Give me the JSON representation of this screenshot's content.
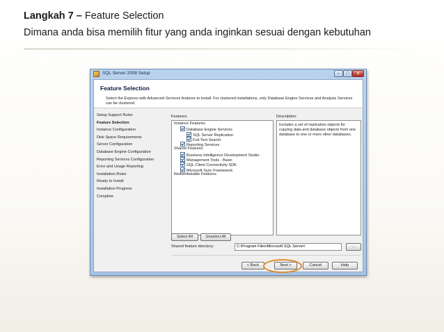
{
  "slide": {
    "title_bold": "Langkah 7 –",
    "title_rest": " Feature Selection",
    "subtitle": "Dimana anda bisa memilih fitur yang anda inginkan sesuai dengan kebutuhan"
  },
  "window": {
    "title": "SQL Server 2008 Setup",
    "minimize": "–",
    "maximize": "□",
    "close": "x"
  },
  "header": {
    "title": "Feature Selection",
    "description": "Select the Express with Advanced Services features to install. For clustered installations, only Database Engine Services and Analysis Services can be clustered."
  },
  "steps": [
    {
      "label": "Setup Support Rules",
      "active": false
    },
    {
      "label": "Feature Selection",
      "active": true
    },
    {
      "label": "Instance Configuration",
      "active": false
    },
    {
      "label": "Disk Space Requirements",
      "active": false
    },
    {
      "label": "Server Configuration",
      "active": false
    },
    {
      "label": "Database Engine Configuration",
      "active": false
    },
    {
      "label": "Reporting Services Configuration",
      "active": false
    },
    {
      "label": "Error and Usage Reporting",
      "active": false
    },
    {
      "label": "Installation Rules",
      "active": false
    },
    {
      "label": "Ready to Install",
      "active": false
    },
    {
      "label": "Installation Progress",
      "active": false
    },
    {
      "label": "Complete",
      "active": false
    }
  ],
  "features_label": "Features:",
  "features": [
    {
      "label": "Instance Features",
      "level": 0,
      "checkbox": false
    },
    {
      "label": "Database Engine Services",
      "level": 1,
      "checkbox": true
    },
    {
      "label": "SQL Server Replication",
      "level": 2,
      "checkbox": true
    },
    {
      "label": "Full-Text Search",
      "level": 2,
      "checkbox": true
    },
    {
      "label": "Reporting Services",
      "level": 1,
      "checkbox": true
    },
    {
      "label": "Shared Features",
      "level": 0,
      "checkbox": false
    },
    {
      "label": "Business Intelligence Development Studio",
      "level": 1,
      "checkbox": true
    },
    {
      "label": "Management Tools - Basic",
      "level": 1,
      "checkbox": true
    },
    {
      "label": "SQL Client Connectivity SDK",
      "level": 1,
      "checkbox": true
    },
    {
      "label": "Microsoft Sync Framework",
      "level": 1,
      "checkbox": true
    },
    {
      "label": "Redistributable Features",
      "level": 0,
      "checkbox": false
    }
  ],
  "description_label": "Description:",
  "description_text": "Includes a set of replication objects for copying data and database objects from one database to one or more other databases.",
  "buttons": {
    "select_all": "Select All",
    "unselect_all": "Unselect All",
    "browse": "...",
    "back": "< Back",
    "next": "Next >",
    "cancel": "Cancel",
    "help": "Help"
  },
  "shared_dir": {
    "label": "Shared feature directory:",
    "value": "C:\\Program Files\\Microsoft SQL Server\\"
  },
  "colors": {
    "highlight_ring": "#e08a2a",
    "window_frame": "#a7c3e6"
  }
}
